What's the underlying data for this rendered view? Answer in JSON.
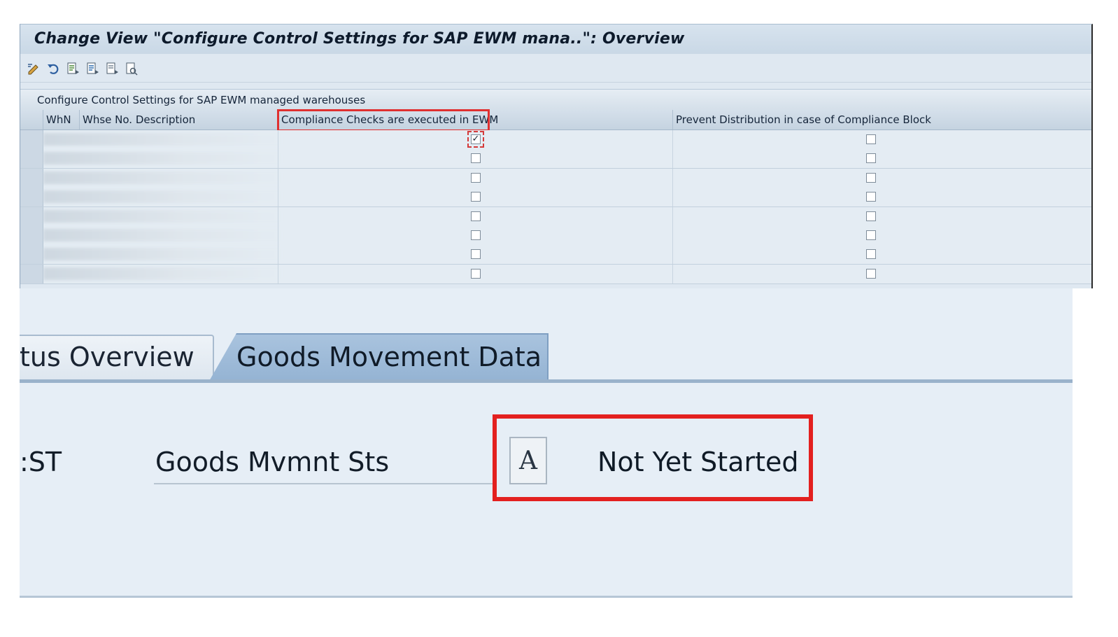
{
  "window": {
    "title": "Change View \"Configure Control Settings for SAP EWM mana..\": Overview"
  },
  "toolbar": {
    "icons": [
      "display-change-icon",
      "undo-icon",
      "new-entries-icon",
      "copy-icon",
      "delete-icon",
      "select-all-icon"
    ]
  },
  "table": {
    "section_title": "Configure Control Settings for SAP EWM managed warehouses",
    "columns": {
      "whn": "WhN",
      "desc": "Whse No. Description",
      "compliance": "Compliance Checks are executed in EWM",
      "prevent": "Prevent Distribution in case of Compliance Block"
    },
    "rows": [
      {
        "compliance": true,
        "prevent": false
      },
      {
        "compliance": false,
        "prevent": false
      },
      {
        "compliance": false,
        "prevent": false
      },
      {
        "compliance": false,
        "prevent": false
      },
      {
        "compliance": false,
        "prevent": false
      },
      {
        "compliance": false,
        "prevent": false
      },
      {
        "compliance": false,
        "prevent": false
      },
      {
        "compliance": false,
        "prevent": false
      }
    ]
  },
  "tabs": {
    "inactive_label": "tus Overview",
    "active_label": "Goods Movement Data"
  },
  "detail": {
    "cut_label": ":ST",
    "field_label": "Goods Mvmnt Sts",
    "status_code": "A",
    "status_text": "Not Yet Started"
  },
  "colors": {
    "highlight": "#e3201f",
    "active_tab": "#a9c3de"
  }
}
